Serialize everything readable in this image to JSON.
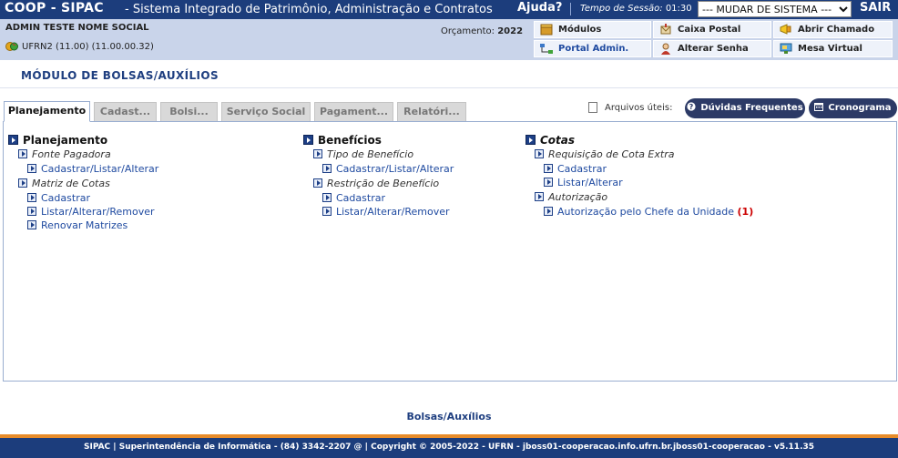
{
  "topbar": {
    "system_name": "COOP - SIPAC",
    "subtitle": "- Sistema Integrado de Patrimônio, Administração e Contratos",
    "help": "Ajuda?",
    "session_label": "Tempo de Sessão:",
    "session_time": "01:30",
    "system_select": "--- MUDAR DE SISTEMA ---",
    "logout": "SAIR"
  },
  "user": {
    "name": "ADMIN TESTE NOME SOCIAL",
    "unit": "UFRN2 (11.00) (11.00.00.32)",
    "budget_label": "Orçamento:",
    "budget_year": "2022"
  },
  "quick_links": {
    "modules": "Módulos",
    "mailbox": "Caixa Postal",
    "ticket": "Abrir Chamado",
    "portal": "Portal Admin.",
    "password": "Alterar Senha",
    "desk": "Mesa Virtual"
  },
  "module_title": "Módulo de Bolsas/Auxílios",
  "tabs": [
    "Planejamento",
    "Cadast...",
    "Bolsi...",
    "Serviço Social",
    "Pagament...",
    "Relatóri..."
  ],
  "toolbar": {
    "files_label": "Arquivos úteis:",
    "faq": "Dúvidas Frequentes",
    "schedule": "Cronograma"
  },
  "menu": {
    "planejamento": {
      "title": "Planejamento",
      "fonte": "Fonte Pagadora",
      "fonte_link": "Cadastrar/Listar/Alterar",
      "matriz": "Matriz de Cotas",
      "matriz_cad": "Cadastrar",
      "matriz_list": "Listar/Alterar/Remover",
      "matriz_renovar": "Renovar Matrizes"
    },
    "beneficios": {
      "title": "Benefícios",
      "tipo": "Tipo de Benefício",
      "tipo_link": "Cadastrar/Listar/Alterar",
      "restricao": "Restrição de Benefício",
      "restricao_cad": "Cadastrar",
      "restricao_list": "Listar/Alterar/Remover"
    },
    "cotas": {
      "title": "Cotas",
      "requisicao": "Requisição de Cota Extra",
      "req_cad": "Cadastrar",
      "req_list": "Listar/Alterar",
      "autorizacao": "Autorização",
      "aut_link": "Autorização pelo Chefe da Unidade",
      "aut_count": "(1)"
    }
  },
  "footer": {
    "link": "Bolsas/Auxílios",
    "text": "SIPAC | Superintendência de Informática - (84) 3342-2207 @ | Copyright © 2005-2022 - UFRN - jboss01-cooperacao.info.ufrn.br.jboss01-cooperacao - v5.11.35"
  },
  "colors": {
    "header_bg": "#1c3d7c",
    "info_bg": "#c9d4ea",
    "link": "#1f4aa0",
    "accent_orange": "#e88c2a",
    "count_red": "#cc0000"
  }
}
